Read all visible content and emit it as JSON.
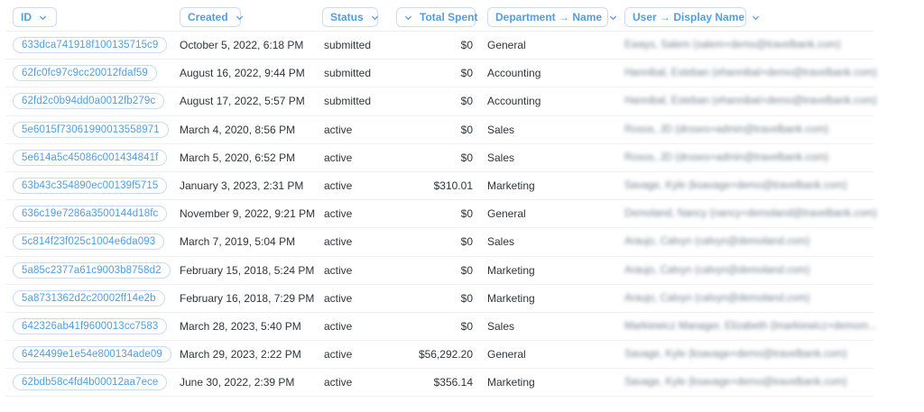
{
  "columns": {
    "id": "ID",
    "created": "Created",
    "status": "Status",
    "total_spent": "Total Spent",
    "department": "Department → Name",
    "user": "User → Display Name"
  },
  "rows": [
    {
      "id": "633dca741918f100135715c9",
      "created": "October 5, 2022, 6:18 PM",
      "status": "submitted",
      "total": "$0",
      "department": "General",
      "user": "Eways, Salem (salem+demo@travelbank.com)"
    },
    {
      "id": "62fc0fc97c9cc20012fdaf59",
      "created": "August 16, 2022, 9:44 PM",
      "status": "submitted",
      "total": "$0",
      "department": "Accounting",
      "user": "Hannibal, Esteban (ehannibal+demo@travelbank.com)"
    },
    {
      "id": "62fd2c0b94dd0a0012fb279c",
      "created": "August 17, 2022, 5:57 PM",
      "status": "submitted",
      "total": "$0",
      "department": "Accounting",
      "user": "Hannibal, Esteban (ehannibal+demo@travelbank.com)"
    },
    {
      "id": "5e6015f73061990013558971",
      "created": "March 4, 2020, 8:56 PM",
      "status": "active",
      "total": "$0",
      "department": "Sales",
      "user": "Rosos, JD (droses+admin@travelbank.com)"
    },
    {
      "id": "5e614a5c45086c001434841f",
      "created": "March 5, 2020, 6:52 PM",
      "status": "active",
      "total": "$0",
      "department": "Sales",
      "user": "Rosos, JD (droses+admin@travelbank.com)"
    },
    {
      "id": "63b43c354890ec00139f5715",
      "created": "January 3, 2023, 2:31 PM",
      "status": "active",
      "total": "$310.01",
      "department": "Marketing",
      "user": "Savage, Kyle (ksavage+demo@travelbank.com)"
    },
    {
      "id": "636c19e7286a3500144d18fc",
      "created": "November 9, 2022, 9:21 PM",
      "status": "active",
      "total": "$0",
      "department": "General",
      "user": "Demoland, Nancy (nancy+demoland@travelbank.com)"
    },
    {
      "id": "5c814f23f025c1004e6da093",
      "created": "March 7, 2019, 5:04 PM",
      "status": "active",
      "total": "$0",
      "department": "Sales",
      "user": "Araujo, Calvyn (calvyn@demoland.com)"
    },
    {
      "id": "5a85c2377a61c9003b8758d2",
      "created": "February 15, 2018, 5:24 PM",
      "status": "active",
      "total": "$0",
      "department": "Marketing",
      "user": "Araujo, Calvyn (calvyn@demoland.com)"
    },
    {
      "id": "5a8731362d2c20002ff14e2b",
      "created": "February 16, 2018, 7:29 PM",
      "status": "active",
      "total": "$0",
      "department": "Marketing",
      "user": "Araujo, Calvyn (calvyn@demoland.com)"
    },
    {
      "id": "642326ab41f9600013cc7583",
      "created": "March 28, 2023, 5:40 PM",
      "status": "active",
      "total": "$0",
      "department": "Sales",
      "user": "Markiewicz Manager, Elizabeth (lmarkiewicz+demom..."
    },
    {
      "id": "6424499e1e54e800134ade09",
      "created": "March 29, 2023, 2:22 PM",
      "status": "active",
      "total": "$56,292.20",
      "department": "General",
      "user": "Savage, Kyle (ksavage+demo@travelbank.com)"
    },
    {
      "id": "62bdb58c4fd4b00012aa7ece",
      "created": "June 30, 2022, 2:39 PM",
      "status": "active",
      "total": "$356.14",
      "department": "Marketing",
      "user": "Savage, Kyle (ksavage+demo@travelbank.com)"
    }
  ],
  "icons": {
    "column_menu": "chevron-down-icon"
  },
  "colors": {
    "accent": "#509ee3",
    "pill_border": "#c9dcf3",
    "text": "#2e353b"
  }
}
